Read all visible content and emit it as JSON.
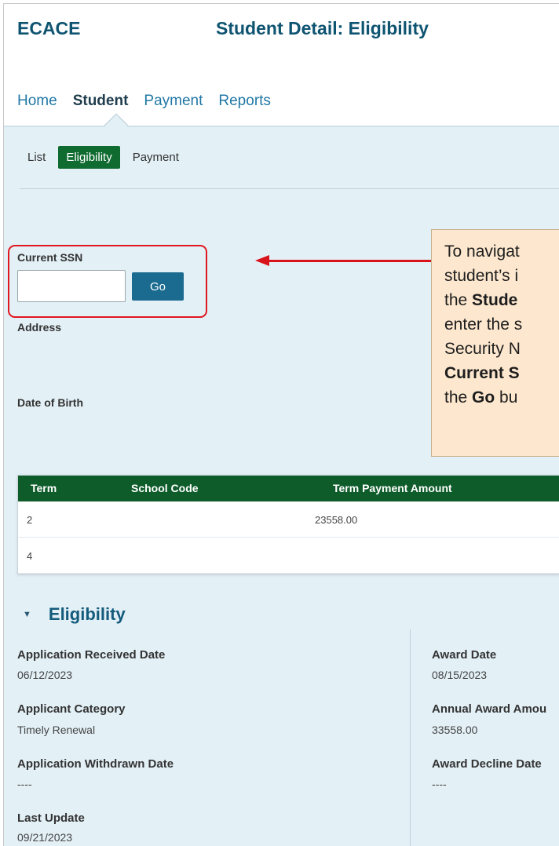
{
  "header": {
    "brand": "ECACE",
    "page_title": "Student Detail: Eligibility",
    "nav": [
      "Home",
      "Student",
      "Payment",
      "Reports"
    ],
    "nav_active": "Student"
  },
  "subnav": {
    "items": [
      "List",
      "Eligibility",
      "Payment"
    ],
    "active": "Eligibility"
  },
  "search": {
    "label": "Current SSN",
    "value": "",
    "go_label": "Go"
  },
  "student": {
    "address_label": "Address",
    "dob_label": "Date of Birth"
  },
  "callout": {
    "segments": [
      {
        "text": "To navigat",
        "bold": false
      },
      {
        "text": "student’s i",
        "bold": false
      },
      {
        "text": "the ",
        "bold": false
      },
      {
        "text": "Stude",
        "bold": true
      },
      {
        "text": "enter the s",
        "bold": false
      },
      {
        "text": "Security N",
        "bold": false
      },
      {
        "text": "Current S",
        "bold": true
      },
      {
        "text": "the ",
        "bold": false
      },
      {
        "text": "Go",
        "bold": true
      },
      {
        "text": " bu",
        "bold": false
      }
    ]
  },
  "term_table": {
    "columns": [
      "Term",
      "School Code",
      "Term Payment Amount"
    ],
    "rows": [
      [
        "2",
        "",
        "23558.00"
      ],
      [
        "4",
        "",
        ""
      ]
    ]
  },
  "eligibility": {
    "title": "Eligibility",
    "left": [
      {
        "label": "Application Received Date",
        "value": "06/12/2023"
      },
      {
        "label": "Applicant Category",
        "value": "Timely Renewal"
      },
      {
        "label": "Application Withdrawn Date",
        "value": "----"
      },
      {
        "label": "Last Update",
        "value": "09/21/2023"
      }
    ],
    "right": [
      {
        "label": "Award Date",
        "value": "08/15/2023"
      },
      {
        "label": "Annual Award Amou",
        "value": "33558.00"
      },
      {
        "label": "Award Decline Date",
        "value": "----"
      }
    ]
  },
  "colors": {
    "brand": "#0e5471",
    "active_tab": "#0f6b30",
    "table_header": "#0f5c2b",
    "go_button": "#1a6b8f",
    "highlight": "#e0171f",
    "callout_bg": "#fde8cf",
    "content_bg": "#e3f0f6"
  }
}
